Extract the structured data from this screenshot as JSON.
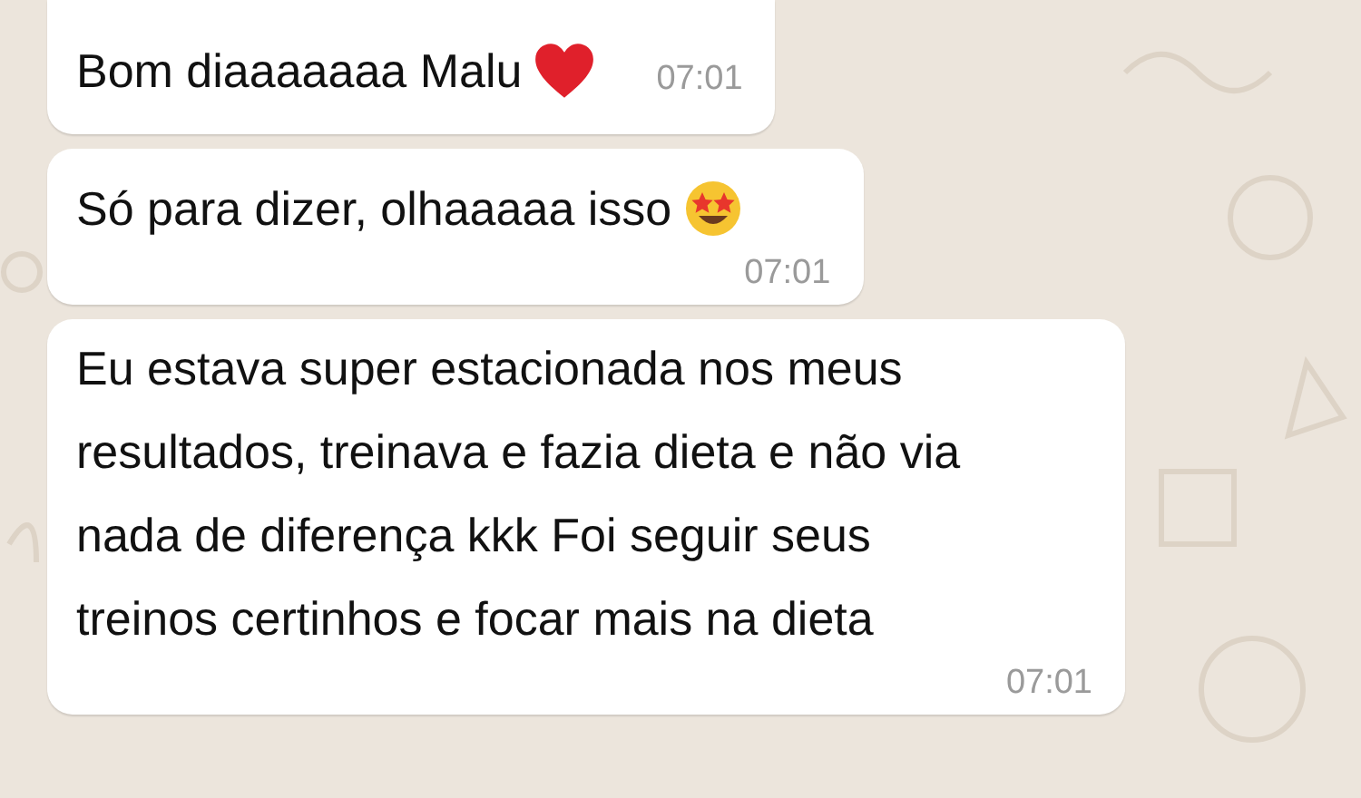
{
  "messages": [
    {
      "text": "Bom diaaaaaaa Malu",
      "kind": "heart",
      "time": "07:01"
    },
    {
      "text": "Só para dizer, olhaaaaa isso",
      "kind": "star-eyes",
      "time": "07:01"
    },
    {
      "text": "Eu estava super estacionada nos meus resultados, treinava e fazia dieta e não via nada de diferença kkk Foi seguir seus treinos certinhos e focar mais na dieta",
      "time": "07:01"
    }
  ]
}
